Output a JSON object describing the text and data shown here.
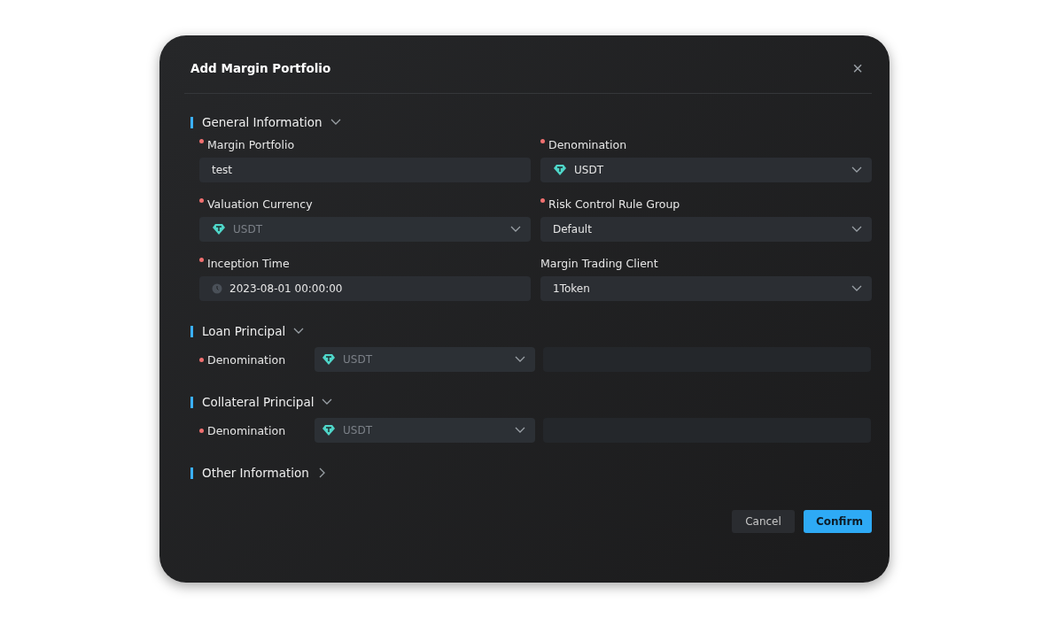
{
  "dialog": {
    "title": "Add Margin Portfolio",
    "close": "×"
  },
  "sections": [
    {
      "title": "General Information",
      "expanded": true,
      "kind": "grid",
      "fields": [
        {
          "label": "Margin Portfolio",
          "required": true,
          "kind": "input",
          "value": "test",
          "disabled": false
        },
        {
          "label": "Denomination",
          "required": true,
          "kind": "currency",
          "value": "USDT",
          "disabled": false
        },
        {
          "label": "Valuation Currency",
          "required": true,
          "kind": "currency",
          "value": "USDT",
          "disabled": true
        },
        {
          "label": "Risk Control Rule Group",
          "required": true,
          "kind": "select",
          "value": "Default",
          "disabled": false
        },
        {
          "label": "Inception Time",
          "required": true,
          "kind": "date",
          "value": "2023-08-01 00:00:00",
          "disabled": false
        },
        {
          "label": "Margin Trading Client",
          "required": false,
          "kind": "select",
          "value": "1Token",
          "disabled": false
        }
      ]
    },
    {
      "title": "Loan Principal",
      "expanded": true,
      "kind": "inline",
      "fields": [
        {
          "label": "Denomination",
          "required": true,
          "kind": "currency",
          "value": "USDT",
          "disabled": true,
          "has_amount": true
        }
      ]
    },
    {
      "title": "Collateral Principal",
      "expanded": true,
      "kind": "inline",
      "fields": [
        {
          "label": "Denomination",
          "required": true,
          "kind": "currency",
          "value": "USDT",
          "disabled": true,
          "has_amount": true
        }
      ]
    },
    {
      "title": "Other Information",
      "expanded": false
    }
  ],
  "buttons": [
    {
      "label": "Cancel",
      "kind": "secondary"
    },
    {
      "label": "Confirm",
      "kind": "primary"
    }
  ]
}
